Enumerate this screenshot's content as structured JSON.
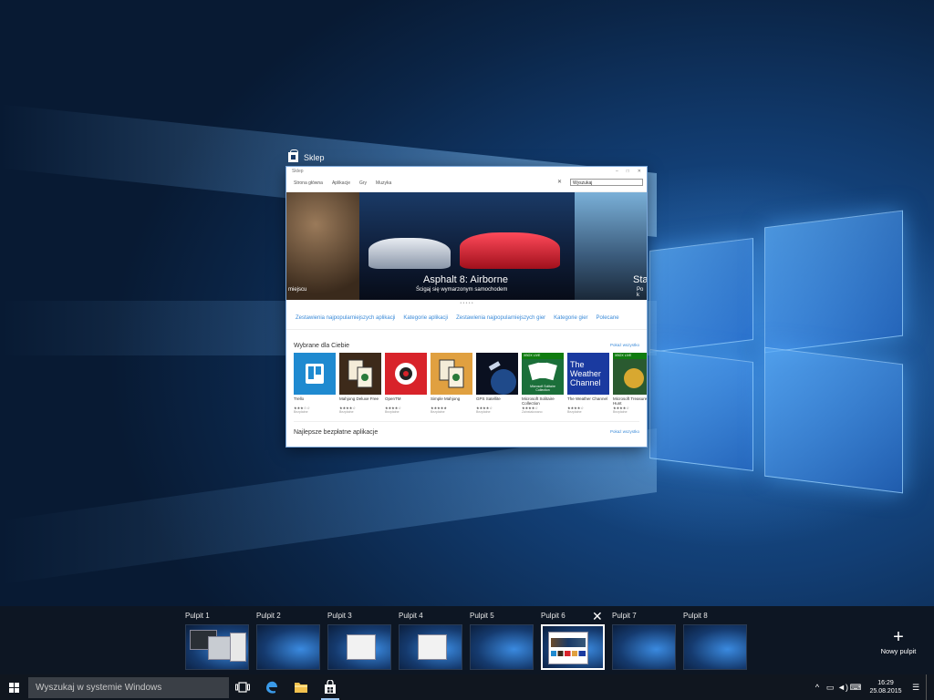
{
  "store_window": {
    "app_title": "Sklep",
    "chrome_title": "Sklep",
    "nav": [
      "Strona główna",
      "Aplikacje",
      "Gry",
      "Muzyka"
    ],
    "search_value": "Wyszukaj",
    "hero": {
      "left_caption": "miejscu",
      "title": "Asphalt 8: Airborne",
      "subtitle": "Ścigaj się wymarzonym samochodem",
      "right_title": "Sta",
      "right_subtitle": "Po k"
    },
    "dots": "• • • • •",
    "category_links": [
      "Zestawienia najpopularniejszych aplikacji",
      "Kategorie aplikacji",
      "Zestawienia najpopularniejszych gier",
      "Kategorie gier",
      "Polecane"
    ],
    "section1_title": "Wybrane dla Ciebie",
    "section2_title": "Najlepsze bezpłatne aplikacje",
    "show_all": "Pokaż wszystko",
    "tiles": [
      {
        "name": "Trello",
        "stars": "★★★☆☆",
        "price": "Bezpłatne",
        "color": "#1f8ad0"
      },
      {
        "name": "Mahjong Deluxe Free",
        "stars": "★★★★☆",
        "price": "Bezpłatne",
        "color": "#3d2a1a"
      },
      {
        "name": "OpenTM",
        "stars": "★★★★☆",
        "price": "Bezpłatne",
        "color": "#d8232a"
      },
      {
        "name": "Simple Mahjong",
        "stars": "★★★★★",
        "price": "Bezpłatne",
        "color": "#e0a040"
      },
      {
        "name": "GPS Satellite",
        "stars": "★★★★☆",
        "price": "Bezpłatne",
        "color": "#0a1020"
      },
      {
        "name": "Microsoft Solitaire Collection",
        "stars": "★★★★☆",
        "price": "Zainstalowano",
        "color": "#1b6f3a"
      },
      {
        "name": "The Weather Channel",
        "stars": "★★★★☆",
        "price": "Bezpłatne",
        "color": "#1a3aa0"
      },
      {
        "name": "Microsoft Treasure Hunt",
        "stars": "★★★★☆",
        "price": "Bezpłatne",
        "color": "#2a5a30"
      }
    ],
    "xbox_badge": "XBOX LIVE",
    "solitaire_label": "Microsoft Solitaire Collection",
    "weather_label": "The Weather Channel"
  },
  "desktops": [
    {
      "label": "Pulpit 1",
      "content": "multi"
    },
    {
      "label": "Pulpit 2",
      "content": "empty"
    },
    {
      "label": "Pulpit 3",
      "content": "window"
    },
    {
      "label": "Pulpit 4",
      "content": "window"
    },
    {
      "label": "Pulpit 5",
      "content": "empty"
    },
    {
      "label": "Pulpit 6",
      "content": "store",
      "active": true
    },
    {
      "label": "Pulpit 7",
      "content": "empty"
    },
    {
      "label": "Pulpit 8",
      "content": "empty"
    }
  ],
  "new_desktop_label": "Nowy pulpit",
  "taskbar": {
    "search_placeholder": "Wyszukaj w systemie Windows",
    "icons": [
      "task-view-icon",
      "edge-icon",
      "file-explorer-icon",
      "store-icon"
    ],
    "time": "16:29",
    "date": "25.08.2015"
  }
}
